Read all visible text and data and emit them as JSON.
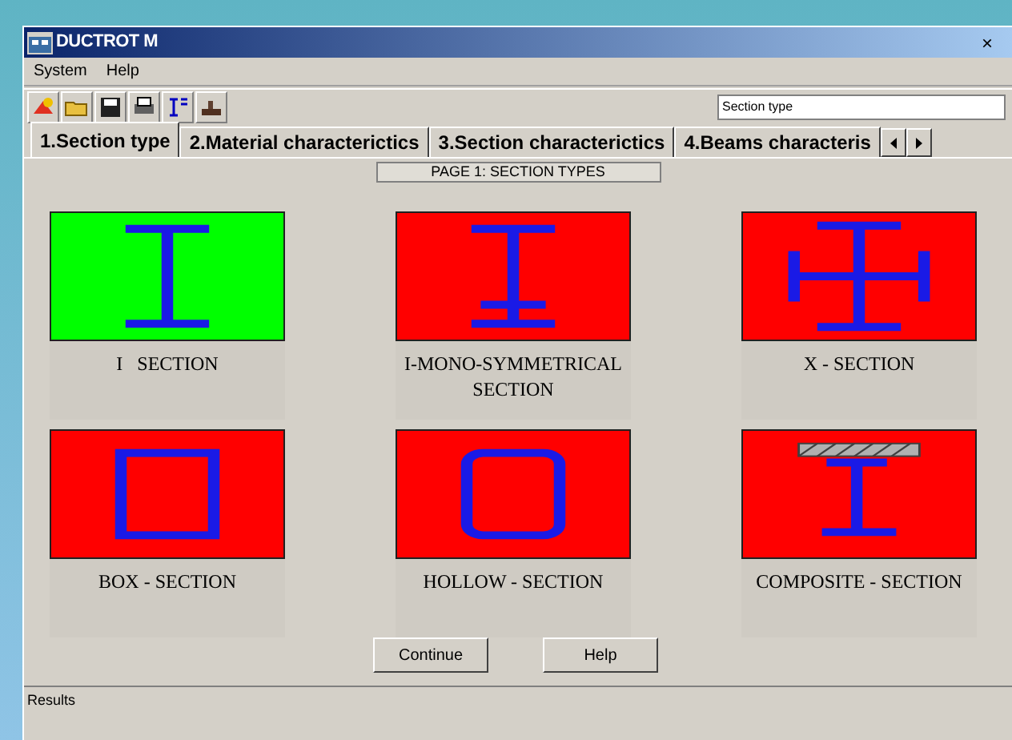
{
  "window": {
    "title": "DUCTROT M",
    "close": "×"
  },
  "menu": [
    "System",
    "Help"
  ],
  "toolbar": {
    "field_value": "Section type"
  },
  "tabs": [
    {
      "label": "1.Section type",
      "selected": true
    },
    {
      "label": "2.Material characterictics",
      "selected": false
    },
    {
      "label": "3.Section characterictics",
      "selected": false
    },
    {
      "label": "4.Beams characteris",
      "selected": false
    }
  ],
  "page_title": "PAGE 1: SECTION TYPES",
  "sections": [
    {
      "kind": "i",
      "label": "I   SECTION",
      "selected": true
    },
    {
      "kind": "mono",
      "label": "I-MONO-SYMMETRICAL SECTION",
      "selected": false
    },
    {
      "kind": "x",
      "label": "X - SECTION",
      "selected": false
    },
    {
      "kind": "box",
      "label": "BOX - SECTION",
      "selected": false
    },
    {
      "kind": "hollow",
      "label": "HOLLOW - SECTION",
      "selected": false
    },
    {
      "kind": "composite",
      "label": "COMPOSITE - SECTION",
      "selected": false
    }
  ],
  "buttons": [
    "Continue",
    "Help"
  ],
  "status_bar": "Results"
}
